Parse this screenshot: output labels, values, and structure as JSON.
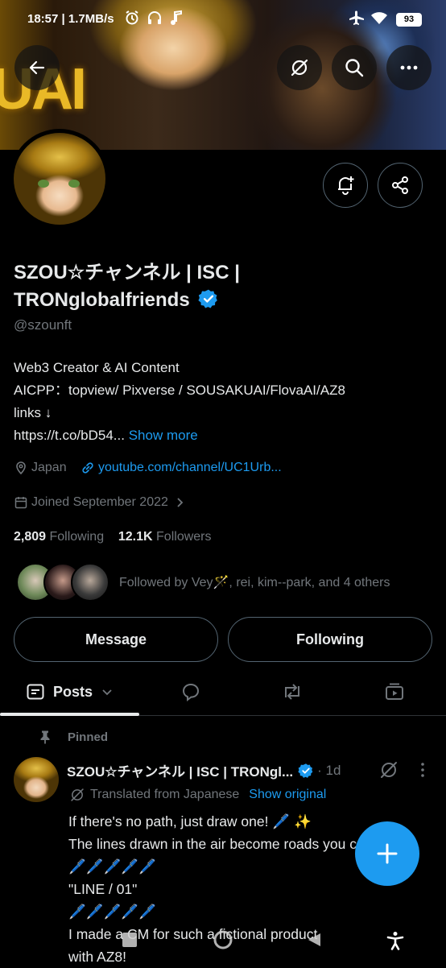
{
  "status_bar": {
    "time": "18:57",
    "speed": "| 1.7MB/s",
    "battery": "93"
  },
  "banner": {
    "bigtext": "UAI"
  },
  "profile": {
    "name": "SZOU☆チャンネル | ISC | TRONglobalfriends",
    "handle": "@szounft",
    "bio_lines": [
      "Web3 Creator & AI Content",
      "AICPP：topview/ Pixverse / SOUSAKUAI/FlovaAI/AZ8",
      "links ↓",
      "https://t.co/bD54..."
    ],
    "show_more": "Show more",
    "location": "Japan",
    "website": "youtube.com/channel/UC1Urb...",
    "joined": "Joined September 2022",
    "following_count": "2,809",
    "following_label": "Following",
    "followers_count": "12.1K",
    "followers_label": "Followers",
    "followed_by": "Followed by Vey🪄, rei, kim--park, and 4 others"
  },
  "actions": {
    "message": "Message",
    "following": "Following"
  },
  "tabs": {
    "posts": "Posts"
  },
  "post": {
    "pinned_label": "Pinned",
    "author": "SZOU☆チャンネル | ISC | TRONgl...",
    "time": "· 1d",
    "translated": "Translated from Japanese",
    "show_original": "Show original",
    "body": "If there's no path, just draw one! 🖊️ ✨\nThe lines drawn in the air become roads you can run on.\n🖊️🖊️🖊️🖊️🖊️\n\"LINE / 01\"\n🖊️🖊️🖊️🖊️🖊️\nI made a CM for such a fictional product\nwith AZ8!"
  },
  "colors": {
    "accent": "#1d9bf0",
    "muted": "#71767b",
    "text": "#e7e9ea",
    "background": "#000000",
    "border": "#536471"
  }
}
